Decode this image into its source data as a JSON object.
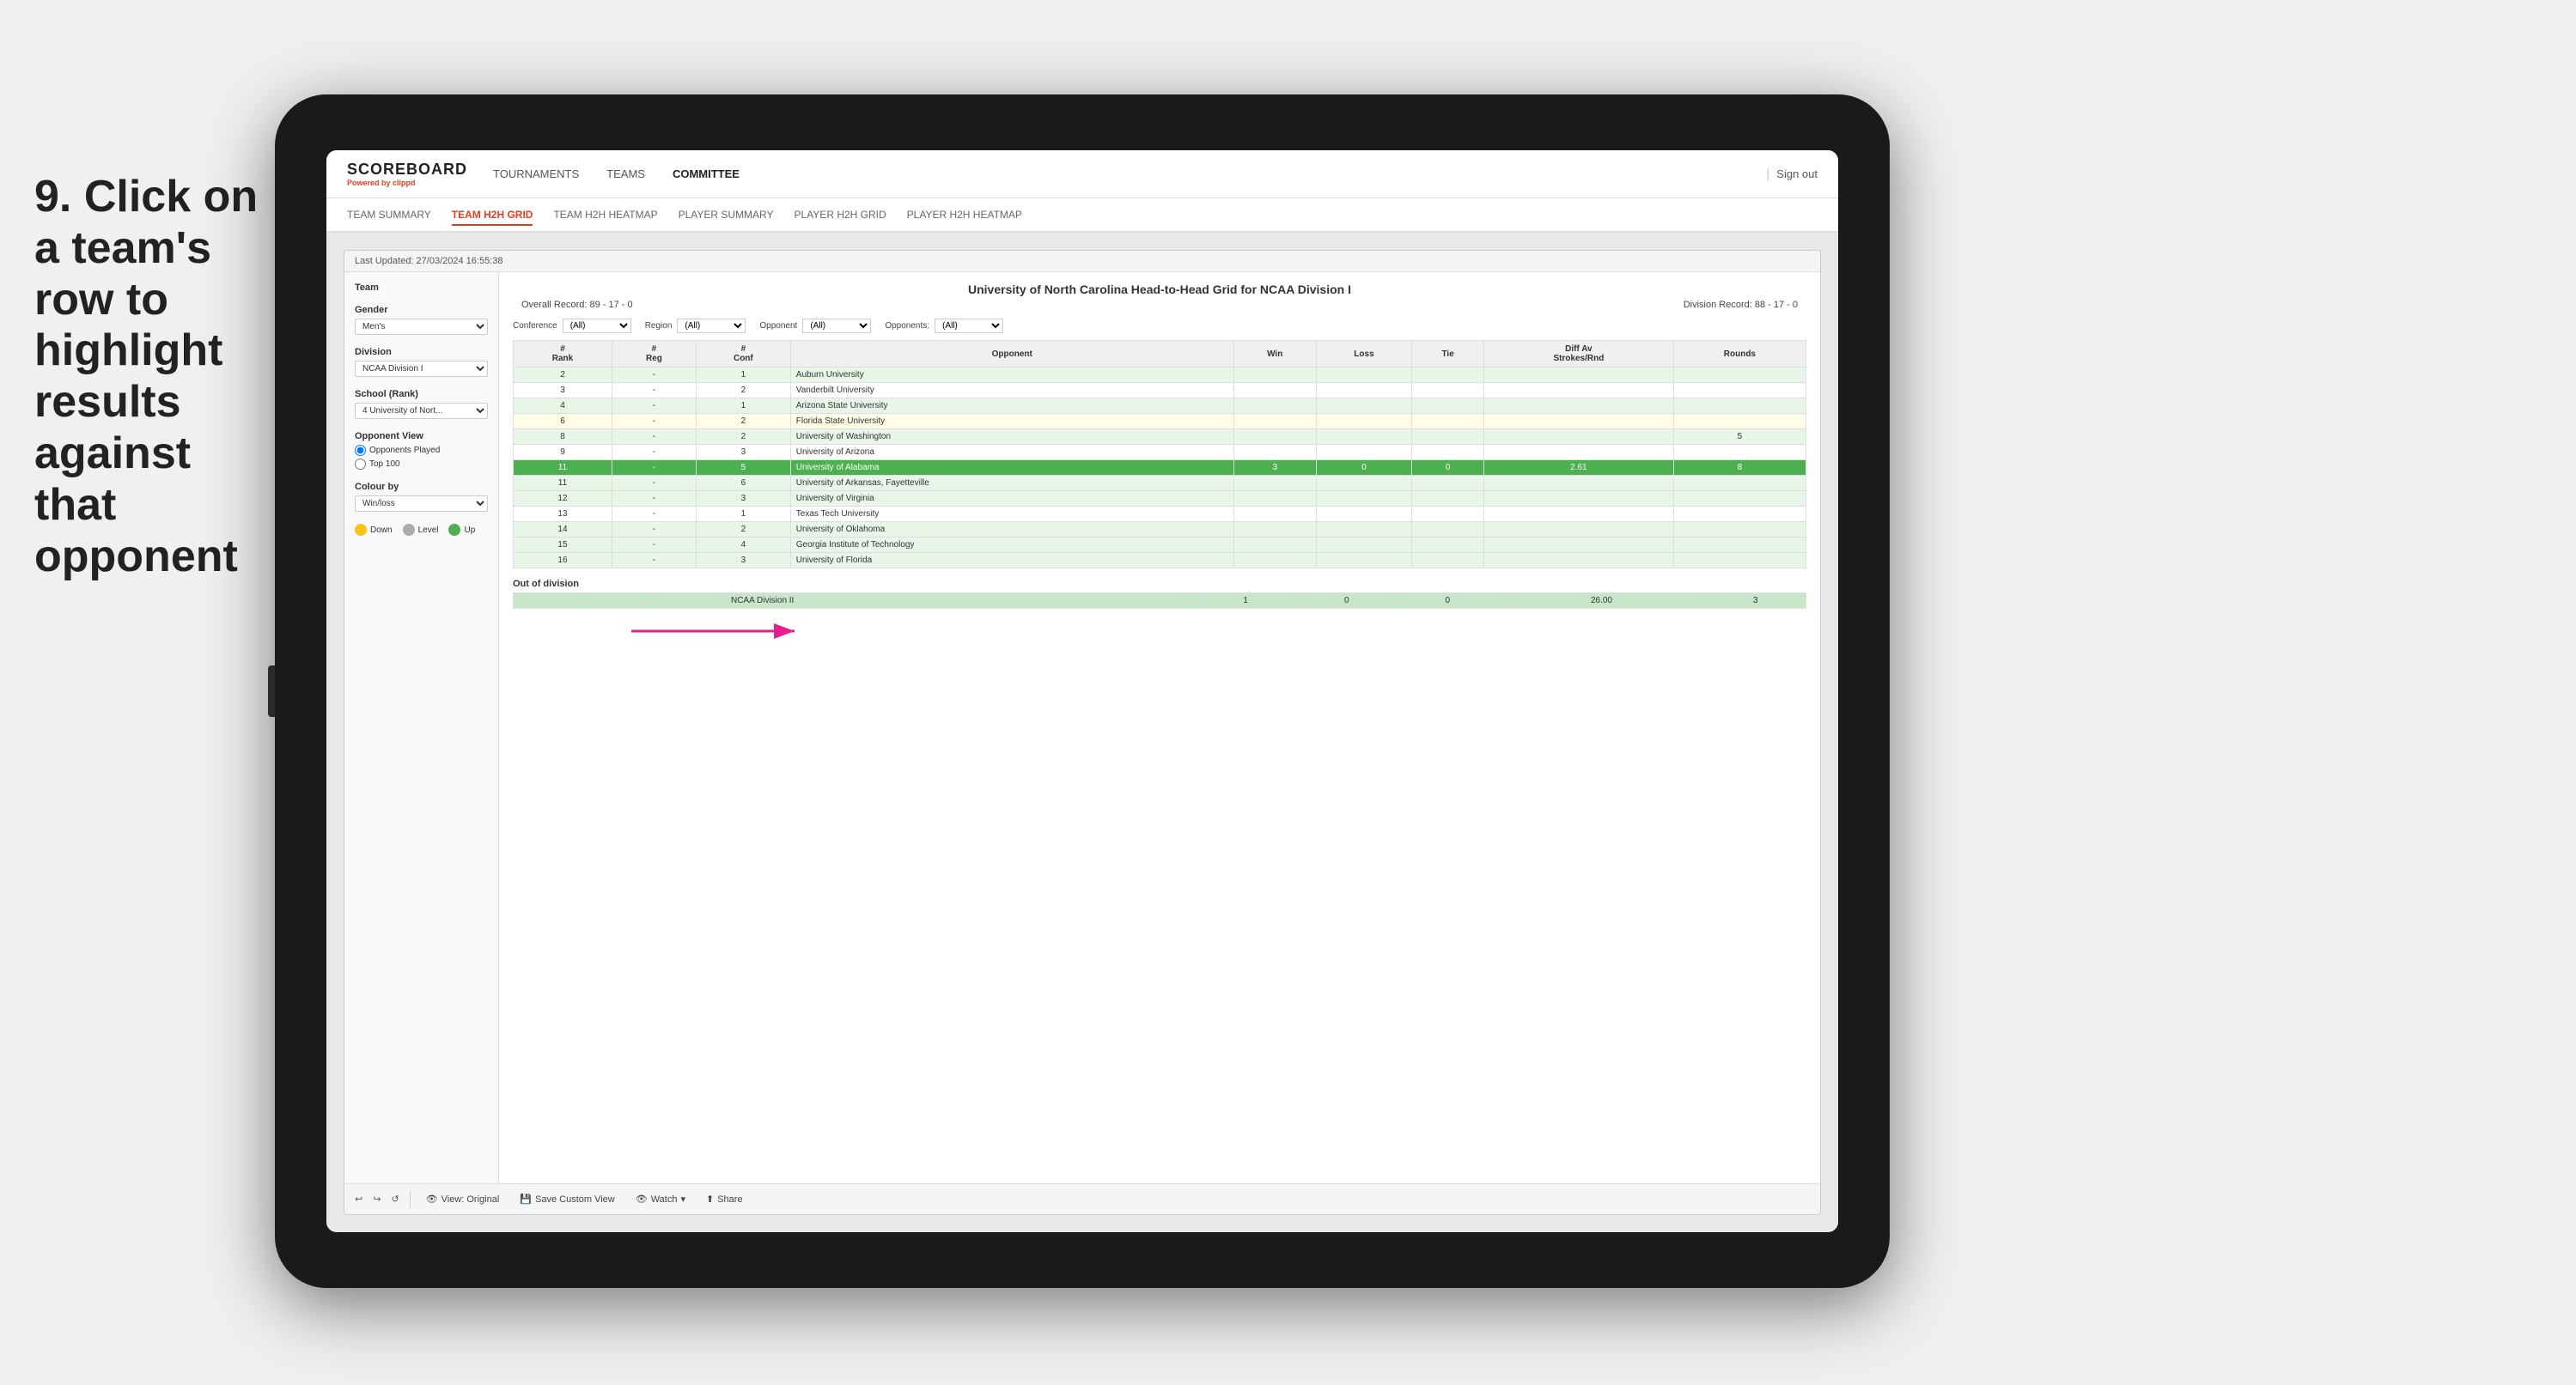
{
  "instruction": {
    "step": "9.",
    "text": "Click on a team's row to highlight results against that opponent"
  },
  "tablet": {
    "nav": {
      "logo": "SCOREBOARD",
      "powered_by": "Powered by",
      "brand": "clippd",
      "items": [
        "TOURNAMENTS",
        "TEAMS",
        "COMMITTEE"
      ],
      "sign_out": "Sign out"
    },
    "sub_nav": {
      "items": [
        "TEAM SUMMARY",
        "TEAM H2H GRID",
        "TEAM H2H HEATMAP",
        "PLAYER SUMMARY",
        "PLAYER H2H GRID",
        "PLAYER H2H HEATMAP"
      ],
      "active": "TEAM H2H GRID"
    },
    "viz": {
      "last_updated": "Last Updated: 27/03/2024 16:55:38",
      "title": "University of North Carolina Head-to-Head Grid for NCAA Division I",
      "overall_record": "Overall Record: 89 - 17 - 0",
      "division_record": "Division Record: 88 - 17 - 0",
      "filters": {
        "conference_label": "Conference",
        "conference_value": "(All)",
        "region_label": "Region",
        "region_value": "(All)",
        "opponent_label": "Opponent",
        "opponent_value": "(All)",
        "opponents_label": "Opponents:",
        "opponents_value": "(All)"
      },
      "sidebar": {
        "team_label": "Team",
        "gender_label": "Gender",
        "gender_value": "Men's",
        "division_label": "Division",
        "division_value": "NCAA Division I",
        "school_label": "School (Rank)",
        "school_value": "4 University of Nort...",
        "opponent_view_label": "Opponent View",
        "opponents_played": "Opponents Played",
        "top_100": "Top 100",
        "colour_by_label": "Colour by",
        "colour_by_value": "Win/loss",
        "legend": {
          "down": "Down",
          "level": "Level",
          "up": "Up"
        }
      },
      "table": {
        "headers": [
          "#\nRank",
          "#\nReg",
          "#\nConf",
          "Opponent",
          "Win",
          "Loss",
          "Tie",
          "Diff Av\nStrokes/Rnd",
          "Rounds"
        ],
        "rows": [
          {
            "rank": "2",
            "reg": "-",
            "conf": "1",
            "opponent": "Auburn University",
            "win": "",
            "loss": "",
            "tie": "",
            "diff": "",
            "rounds": "",
            "style": "light-green"
          },
          {
            "rank": "3",
            "reg": "-",
            "conf": "2",
            "opponent": "Vanderbilt University",
            "win": "",
            "loss": "",
            "tie": "",
            "diff": "",
            "rounds": "",
            "style": "white"
          },
          {
            "rank": "4",
            "reg": "-",
            "conf": "1",
            "opponent": "Arizona State University",
            "win": "",
            "loss": "",
            "tie": "",
            "diff": "",
            "rounds": "",
            "style": "light-green"
          },
          {
            "rank": "6",
            "reg": "-",
            "conf": "2",
            "opponent": "Florida State University",
            "win": "",
            "loss": "",
            "tie": "",
            "diff": "",
            "rounds": "",
            "style": "light-yellow"
          },
          {
            "rank": "8",
            "reg": "-",
            "conf": "2",
            "opponent": "University of Washington",
            "win": "",
            "loss": "",
            "tie": "",
            "diff": "",
            "rounds": "5",
            "style": "light-green"
          },
          {
            "rank": "9",
            "reg": "-",
            "conf": "3",
            "opponent": "University of Arizona",
            "win": "",
            "loss": "",
            "tie": "",
            "diff": "",
            "rounds": "",
            "style": "white"
          },
          {
            "rank": "11",
            "reg": "-",
            "conf": "5",
            "opponent": "University of Alabama",
            "win": "3",
            "loss": "0",
            "tie": "0",
            "diff": "2.61",
            "rounds": "8",
            "style": "highlighted"
          },
          {
            "rank": "11",
            "reg": "-",
            "conf": "6",
            "opponent": "University of Arkansas, Fayetteville",
            "win": "",
            "loss": "",
            "tie": "",
            "diff": "",
            "rounds": "",
            "style": "light-green"
          },
          {
            "rank": "12",
            "reg": "-",
            "conf": "3",
            "opponent": "University of Virginia",
            "win": "",
            "loss": "",
            "tie": "",
            "diff": "",
            "rounds": "",
            "style": "light-green"
          },
          {
            "rank": "13",
            "reg": "-",
            "conf": "1",
            "opponent": "Texas Tech University",
            "win": "",
            "loss": "",
            "tie": "",
            "diff": "",
            "rounds": "",
            "style": "white"
          },
          {
            "rank": "14",
            "reg": "-",
            "conf": "2",
            "opponent": "University of Oklahoma",
            "win": "",
            "loss": "",
            "tie": "",
            "diff": "",
            "rounds": "",
            "style": "light-green"
          },
          {
            "rank": "15",
            "reg": "-",
            "conf": "4",
            "opponent": "Georgia Institute of Technology",
            "win": "",
            "loss": "",
            "tie": "",
            "diff": "",
            "rounds": "",
            "style": "light-green"
          },
          {
            "rank": "16",
            "reg": "-",
            "conf": "3",
            "opponent": "University of Florida",
            "win": "",
            "loss": "",
            "tie": "",
            "diff": "",
            "rounds": "",
            "style": "light-green"
          }
        ],
        "out_of_division_title": "Out of division",
        "out_of_division_rows": [
          {
            "label": "NCAA Division II",
            "win": "1",
            "loss": "0",
            "tie": "0",
            "diff": "26.00",
            "rounds": "3",
            "style": "green"
          }
        ]
      },
      "toolbar": {
        "view_original": "View: Original",
        "save_custom_view": "Save Custom View",
        "watch": "Watch",
        "share": "Share"
      }
    }
  }
}
